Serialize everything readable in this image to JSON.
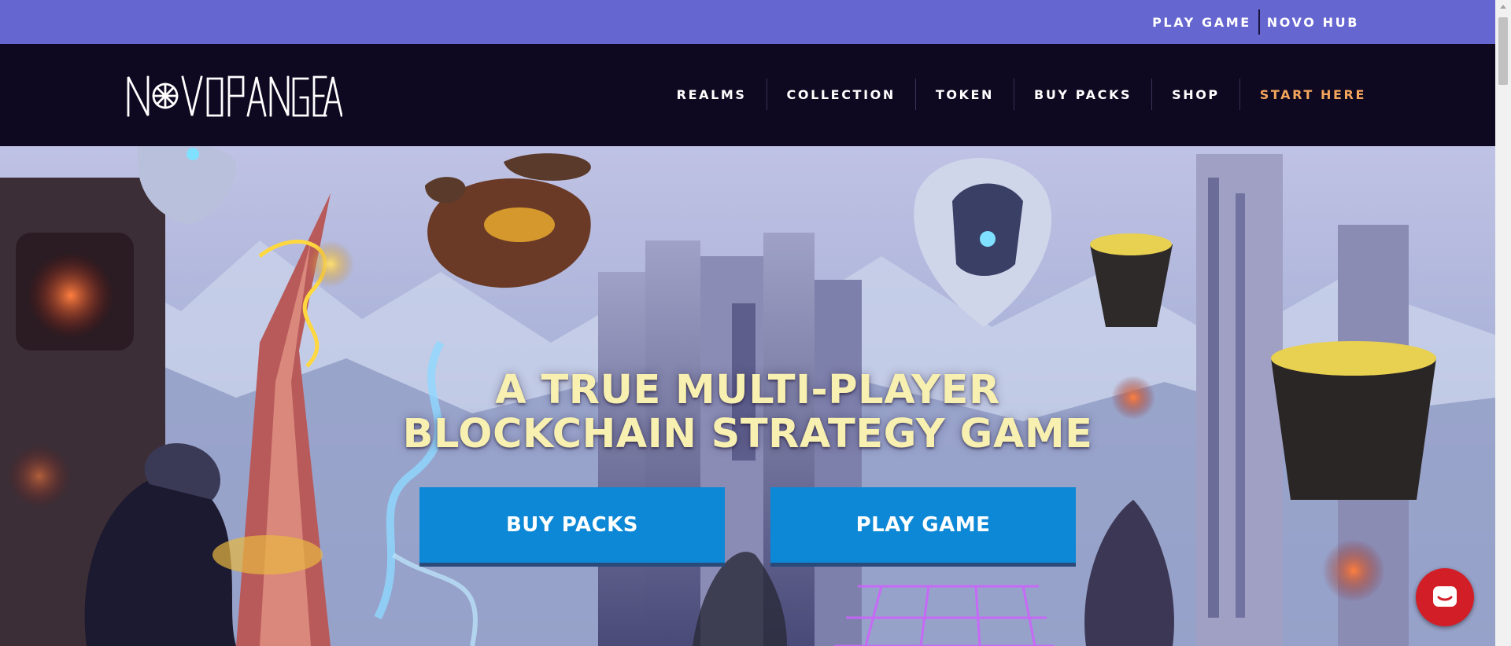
{
  "topbar": {
    "links": [
      "PLAY GAME",
      "NOVO HUB"
    ]
  },
  "brand": {
    "logo_text": "NOVOPANGEA"
  },
  "nav": {
    "items": [
      "REALMS",
      "COLLECTION",
      "TOKEN",
      "BUY PACKS",
      "SHOP",
      "START HERE"
    ]
  },
  "hero": {
    "headline_line1": "A TRUE MULTI-PLAYER",
    "headline_line2": "BLOCKCHAIN STRATEGY GAME",
    "buy_label": "BUY PACKS",
    "play_label": "PLAY GAME"
  },
  "colors": {
    "topbar": "#6666d0",
    "nav_bg": "#0e0820",
    "accent": "#f3a55c",
    "cta": "#0c88d6",
    "headline": "#f8f0b0",
    "chat": "#d21f27"
  },
  "icons": [
    "wheel-logo-icon",
    "chat-icon"
  ]
}
